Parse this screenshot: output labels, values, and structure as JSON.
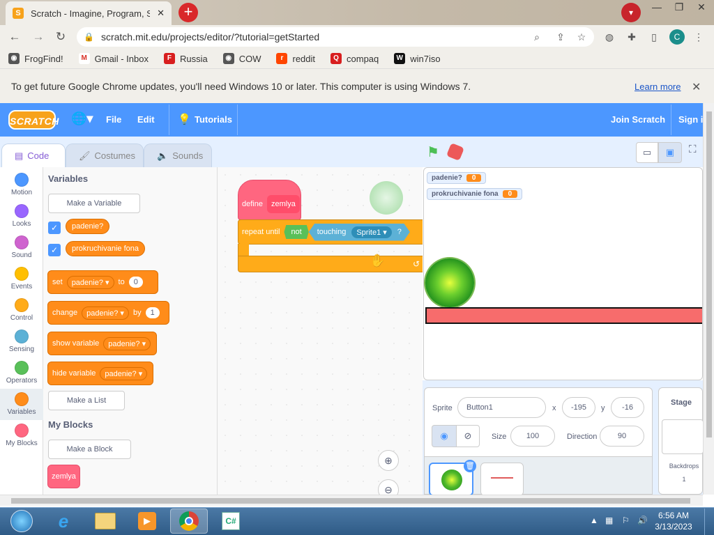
{
  "browser": {
    "tab_title": "Scratch - Imagine, Program, Shar",
    "tab_favicon": "S",
    "new_tab_icon": "+",
    "url": "scratch.mit.edu/projects/editor/?tutorial=getStarted",
    "profile_initial": "C",
    "bookmarks": [
      {
        "label": "FrogFind!",
        "icon": "globe-icon",
        "color": "#555555",
        "glyph": "◉"
      },
      {
        "label": "Gmail - Inbox",
        "icon": "gmail-icon",
        "color": "#d93025",
        "glyph": "M"
      },
      {
        "label": "Russia",
        "icon": "russia-icon",
        "color": "#d81e1e",
        "glyph": "F"
      },
      {
        "label": "COW",
        "icon": "globe-icon",
        "color": "#555555",
        "glyph": "◉"
      },
      {
        "label": "reddit",
        "icon": "reddit-icon",
        "color": "#ff4500",
        "glyph": "r"
      },
      {
        "label": "compaq",
        "icon": "compaq-icon",
        "color": "#d81e1e",
        "glyph": "Q"
      },
      {
        "label": "win7iso",
        "icon": "win7iso-icon",
        "color": "#111111",
        "glyph": "W"
      }
    ],
    "infobar_text": "To get future Google Chrome updates, you'll need Windows 10 or later. This computer is using Windows 7.",
    "infobar_link": "Learn more"
  },
  "scratch": {
    "logo": "SCRATCH",
    "menu": {
      "file": "File",
      "edit": "Edit",
      "tutorials": "Tutorials",
      "join": "Join Scratch",
      "signin": "Sign in"
    },
    "tabs": {
      "code": "Code",
      "costumes": "Costumes",
      "sounds": "Sounds"
    },
    "categories": [
      {
        "label": "Motion",
        "color": "#4c97ff"
      },
      {
        "label": "Looks",
        "color": "#9966ff"
      },
      {
        "label": "Sound",
        "color": "#cf63cf"
      },
      {
        "label": "Events",
        "color": "#ffbf00"
      },
      {
        "label": "Control",
        "color": "#ffab19"
      },
      {
        "label": "Sensing",
        "color": "#5cb1d6"
      },
      {
        "label": "Operators",
        "color": "#59c059"
      },
      {
        "label": "Variables",
        "color": "#ff8c1a"
      },
      {
        "label": "My Blocks",
        "color": "#ff6680"
      }
    ],
    "palette": {
      "variables_heading": "Variables",
      "make_variable": "Make a Variable",
      "var1": "padenie?",
      "var2": "prokruchivanie fona",
      "set_label": "set",
      "set_var": "padenie?",
      "set_to": "to",
      "set_value": "0",
      "change_label": "change",
      "change_var": "padenie?",
      "change_by": "by",
      "change_value": "1",
      "show_label": "show variable",
      "show_var": "padenie?",
      "hide_label": "hide variable",
      "hide_var": "padenie?",
      "make_list": "Make a List",
      "myblocks_heading": "My Blocks",
      "make_block": "Make a Block",
      "custom_block": "zemlya"
    },
    "script": {
      "define": "define",
      "define_name": "zemlya",
      "repeat_until": "repeat until",
      "not": "not",
      "touching": "touching",
      "touching_target": "Sprite1",
      "question": "?"
    },
    "monitors": [
      {
        "label": "padenie?",
        "value": "0"
      },
      {
        "label": "prokruchivanie fona",
        "value": "0"
      }
    ],
    "sprite_info": {
      "sprite_label": "Sprite",
      "sprite_name": "Button1",
      "x_label": "x",
      "x": "-195",
      "y_label": "y",
      "y": "-16",
      "show_label": "Show",
      "size_label": "Size",
      "size": "100",
      "direction_label": "Direction",
      "direction": "90"
    },
    "stage_panel": {
      "title": "Stage",
      "backdrops_label": "Backdrops",
      "backdrops_count": "1"
    }
  },
  "taskbar": {
    "time": "6:56 AM",
    "date": "3/13/2023",
    "apps": [
      "start-orb-icon",
      "ie-icon",
      "explorer-icon",
      "media-player-icon",
      "chrome-icon",
      "csharp-icon"
    ]
  },
  "colors": {
    "scratch_blue": "#4c97ff",
    "variables_orange": "#ff8c1a",
    "myblocks_pink": "#ff6680",
    "control_orange": "#ffab19",
    "operators_green": "#59c059",
    "sensing_blue": "#5cb1d6"
  }
}
